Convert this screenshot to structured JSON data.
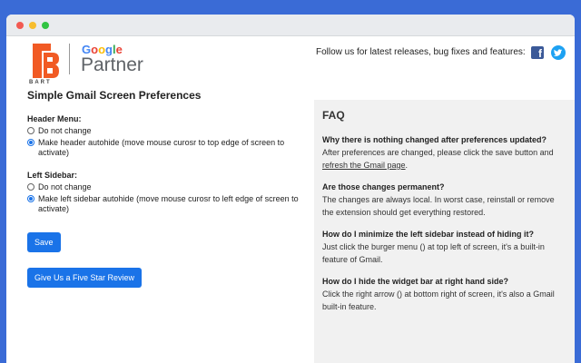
{
  "window": {
    "title": ""
  },
  "header": {
    "bart_text": "BART",
    "google_letters": [
      {
        "ch": "G",
        "color": "#4285F4"
      },
      {
        "ch": "o",
        "color": "#EA4335"
      },
      {
        "ch": "o",
        "color": "#FBBC05"
      },
      {
        "ch": "g",
        "color": "#4285F4"
      },
      {
        "ch": "l",
        "color": "#34A853"
      },
      {
        "ch": "e",
        "color": "#EA4335"
      }
    ],
    "partner_text": "Partner",
    "follow_text": "Follow us for latest releases, bug fixes and features:",
    "facebook_icon": "facebook-icon",
    "twitter_icon": "twitter-icon"
  },
  "preferences": {
    "title": "Simple Gmail Screen Preferences",
    "header_menu": {
      "label": "Header Menu:",
      "options": [
        {
          "label": "Do not change",
          "checked": false
        },
        {
          "label": "Make header autohide (move mouse curosr to top edge of screen to activate)",
          "checked": true
        }
      ]
    },
    "left_sidebar": {
      "label": "Left Sidebar:",
      "options": [
        {
          "label": "Do not change",
          "checked": false
        },
        {
          "label": "Make left sidebar autohide (move mouse curosr to left edge of screen to activate)",
          "checked": true
        }
      ]
    },
    "save_label": "Save",
    "review_label": "Give Us a Five Star Review"
  },
  "faq": {
    "title": "FAQ",
    "items": [
      {
        "q": "Why there is nothing changed after preferences updated?",
        "a_pre": "After preferences are changed, please click the save button and ",
        "a_link": "refresh the Gmail page",
        "a_post": "."
      },
      {
        "q": "Are those changes permanent?",
        "a_pre": "The changes are always local. In worst case, reinstall or remove the extension should get everything restored.",
        "a_link": "",
        "a_post": ""
      },
      {
        "q": "How do I minimize the left sidebar instead of hiding it?",
        "a_pre": "Just click the burger menu () at top left of screen, it's a built-in feature of Gmail.",
        "a_link": "",
        "a_post": ""
      },
      {
        "q": "How do I hide the widget bar at right hand side?",
        "a_pre": "Click the right arrow () at bottom right of screen, it's also a Gmail built-in feature.",
        "a_link": "",
        "a_post": ""
      }
    ]
  },
  "colors": {
    "accent": "#1a73e8",
    "background": "#3a6bd6",
    "faq_bg": "#f1f1f1"
  }
}
